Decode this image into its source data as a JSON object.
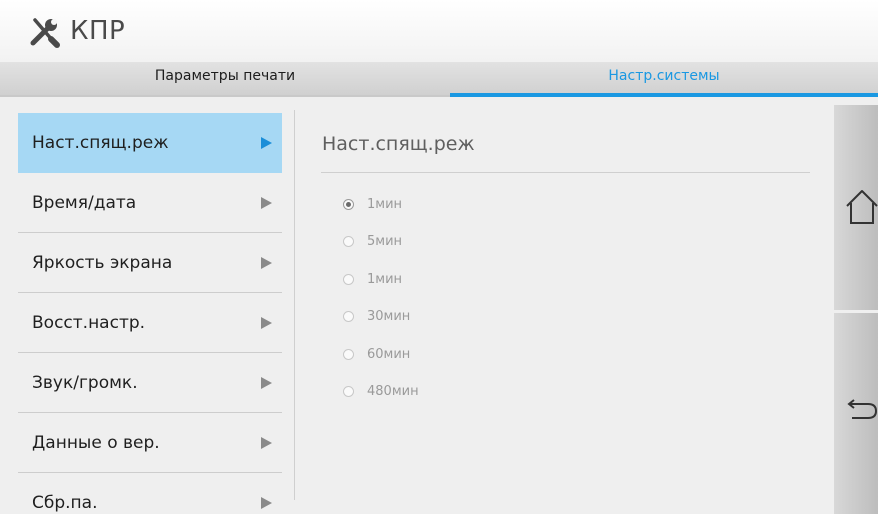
{
  "header": {
    "title": "КПР",
    "icon": "tools-icon"
  },
  "tabs": [
    {
      "label": "Параметры печати",
      "active": false
    },
    {
      "label": "Настр.системы",
      "active": true
    }
  ],
  "menu": {
    "items": [
      {
        "label": "Наст.спящ.реж",
        "active": true
      },
      {
        "label": "Время/дата",
        "active": false
      },
      {
        "label": "Яркость экрана",
        "active": false
      },
      {
        "label": "Восст.настр.",
        "active": false
      },
      {
        "label": "Звук/громк.",
        "active": false
      },
      {
        "label": "Данные о вер.",
        "active": false
      },
      {
        "label": "Сбр.па.",
        "active": false
      }
    ]
  },
  "content": {
    "title": "Наст.спящ.реж",
    "options": [
      {
        "label": "1мин",
        "checked": true
      },
      {
        "label": "5мин",
        "checked": false
      },
      {
        "label": "1мин",
        "checked": false
      },
      {
        "label": "30мин",
        "checked": false
      },
      {
        "label": "60мин",
        "checked": false
      },
      {
        "label": "480мин",
        "checked": false
      }
    ]
  },
  "side_buttons": {
    "home_icon": "home-icon",
    "back_icon": "back-icon"
  },
  "colors": {
    "accent": "#1a98e2",
    "active_bg": "#a6d8f4"
  }
}
